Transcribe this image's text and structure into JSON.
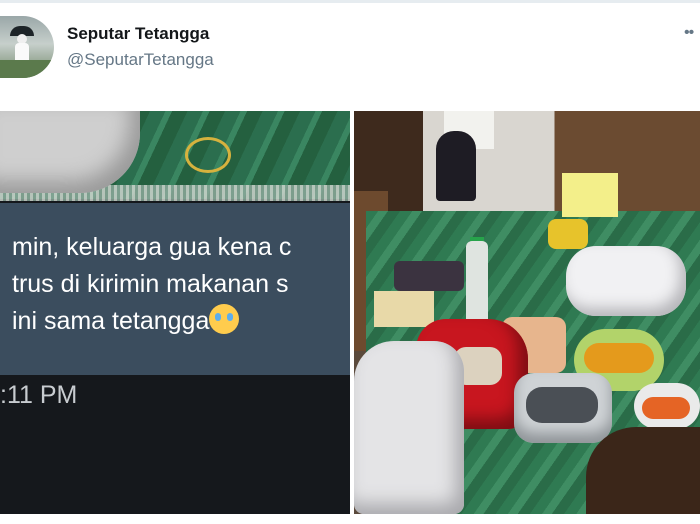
{
  "header": {
    "display_name": "Seputar Tetangga",
    "handle": "@SeputarTetangga",
    "more_label": "••"
  },
  "media": {
    "screenshot": {
      "message": "min, keluarga gua kena c\ntrus di kirimin makanan s\nini sama tetangga",
      "emoji_name": "crying-face-emoji",
      "timestamp": ":11 PM"
    }
  },
  "colors": {
    "bubble": "#3b4d5e",
    "handle": "#657786",
    "emoji": "#ffcc4d"
  }
}
